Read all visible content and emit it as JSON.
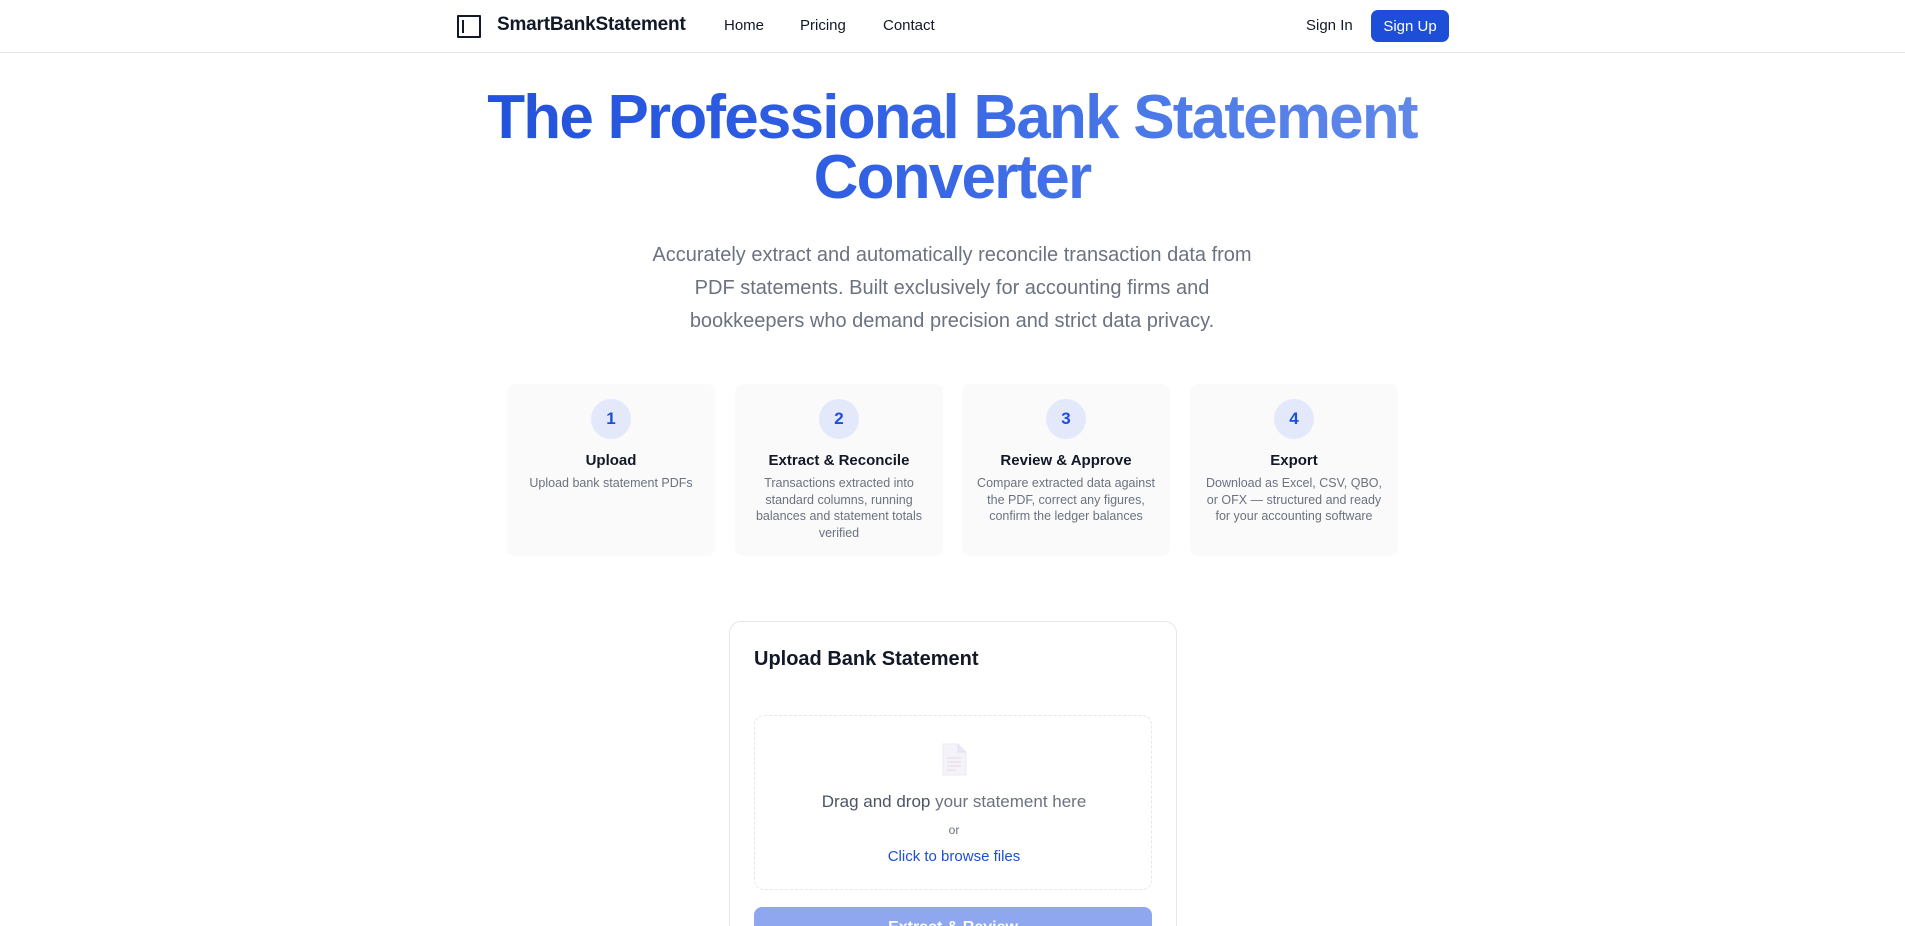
{
  "header": {
    "brand": "SmartBankStatement",
    "nav": [
      {
        "label": "Home"
      },
      {
        "label": "Pricing"
      },
      {
        "label": "Contact"
      }
    ],
    "signin_label": "Sign In",
    "signup_label": "Sign Up"
  },
  "hero": {
    "title_line1": "The Professional Bank Statement",
    "title_line2": "Converter",
    "subtitle_line1": "Accurately extract and automatically reconcile transaction data from",
    "subtitle_line2": "PDF statements. Built exclusively for accounting firms and",
    "subtitle_line3": "bookkeepers who demand precision and strict data privacy."
  },
  "steps": [
    {
      "number": "1",
      "title": "Upload",
      "description": "Upload bank statement PDFs"
    },
    {
      "number": "2",
      "title": "Extract & Reconcile",
      "description": "Transactions extracted into standard columns, running balances and statement totals verified"
    },
    {
      "number": "3",
      "title": "Review & Approve",
      "description": "Compare extracted data against the PDF, correct any figures, confirm the ledger balances"
    },
    {
      "number": "4",
      "title": "Export",
      "description": "Download as Excel, CSV, QBO, or OFX — structured and ready for your accounting software"
    }
  ],
  "upload": {
    "title": "Upload Bank Statement",
    "drop_strong": "Drag and drop",
    "drop_rest": " your statement here",
    "or_text": "or",
    "browse_label": "Click to browse files",
    "extract_label": "Extract & Review"
  },
  "colors": {
    "accent": "#1d4ed8",
    "accent_disabled": "#8ea7ee",
    "step_circle_bg": "#e3e8fb"
  }
}
